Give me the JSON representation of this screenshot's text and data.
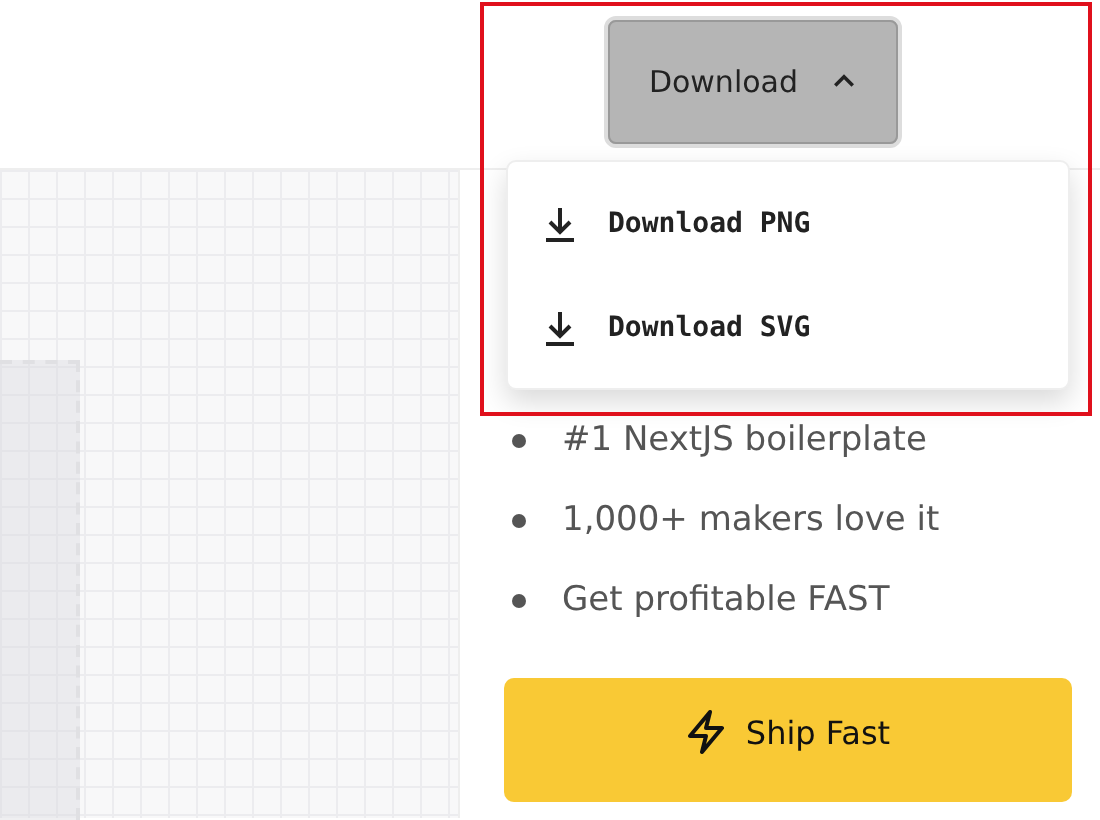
{
  "download_button": {
    "label": "Download",
    "expanded": true
  },
  "download_menu": [
    {
      "label": "Download PNG"
    },
    {
      "label": "Download SVG"
    }
  ],
  "features": [
    "#1 NextJS boilerplate",
    "1,000+ makers love it",
    "Get profitable FAST"
  ],
  "cta_button": {
    "label": "Ship Fast"
  }
}
